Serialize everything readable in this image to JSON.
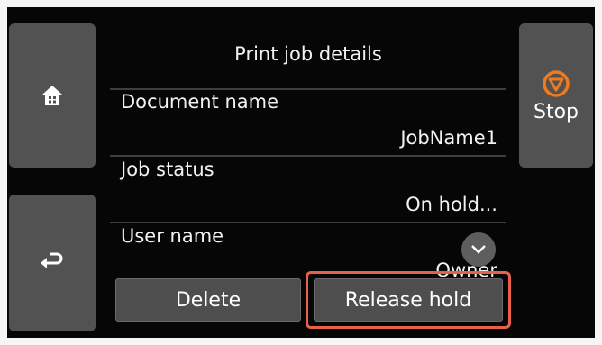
{
  "header": {
    "title": "Print job details"
  },
  "fields": [
    {
      "label": "Document name",
      "value": "JobName1"
    },
    {
      "label": "Job status",
      "value": "On hold..."
    },
    {
      "label": "User name",
      "value": "Owner"
    }
  ],
  "side": {
    "stop_label": "Stop"
  },
  "actions": {
    "delete_label": "Delete",
    "release_label": "Release hold"
  },
  "icons": {
    "home": "home-icon",
    "back": "back-arrow-icon",
    "stop": "stop-icon",
    "scroll": "chevron-down-icon"
  },
  "colors": {
    "stop_accent": "#f07a1e",
    "highlight": "#e8604a",
    "button_bg": "#4e4e4e",
    "screen_bg": "#060606"
  }
}
